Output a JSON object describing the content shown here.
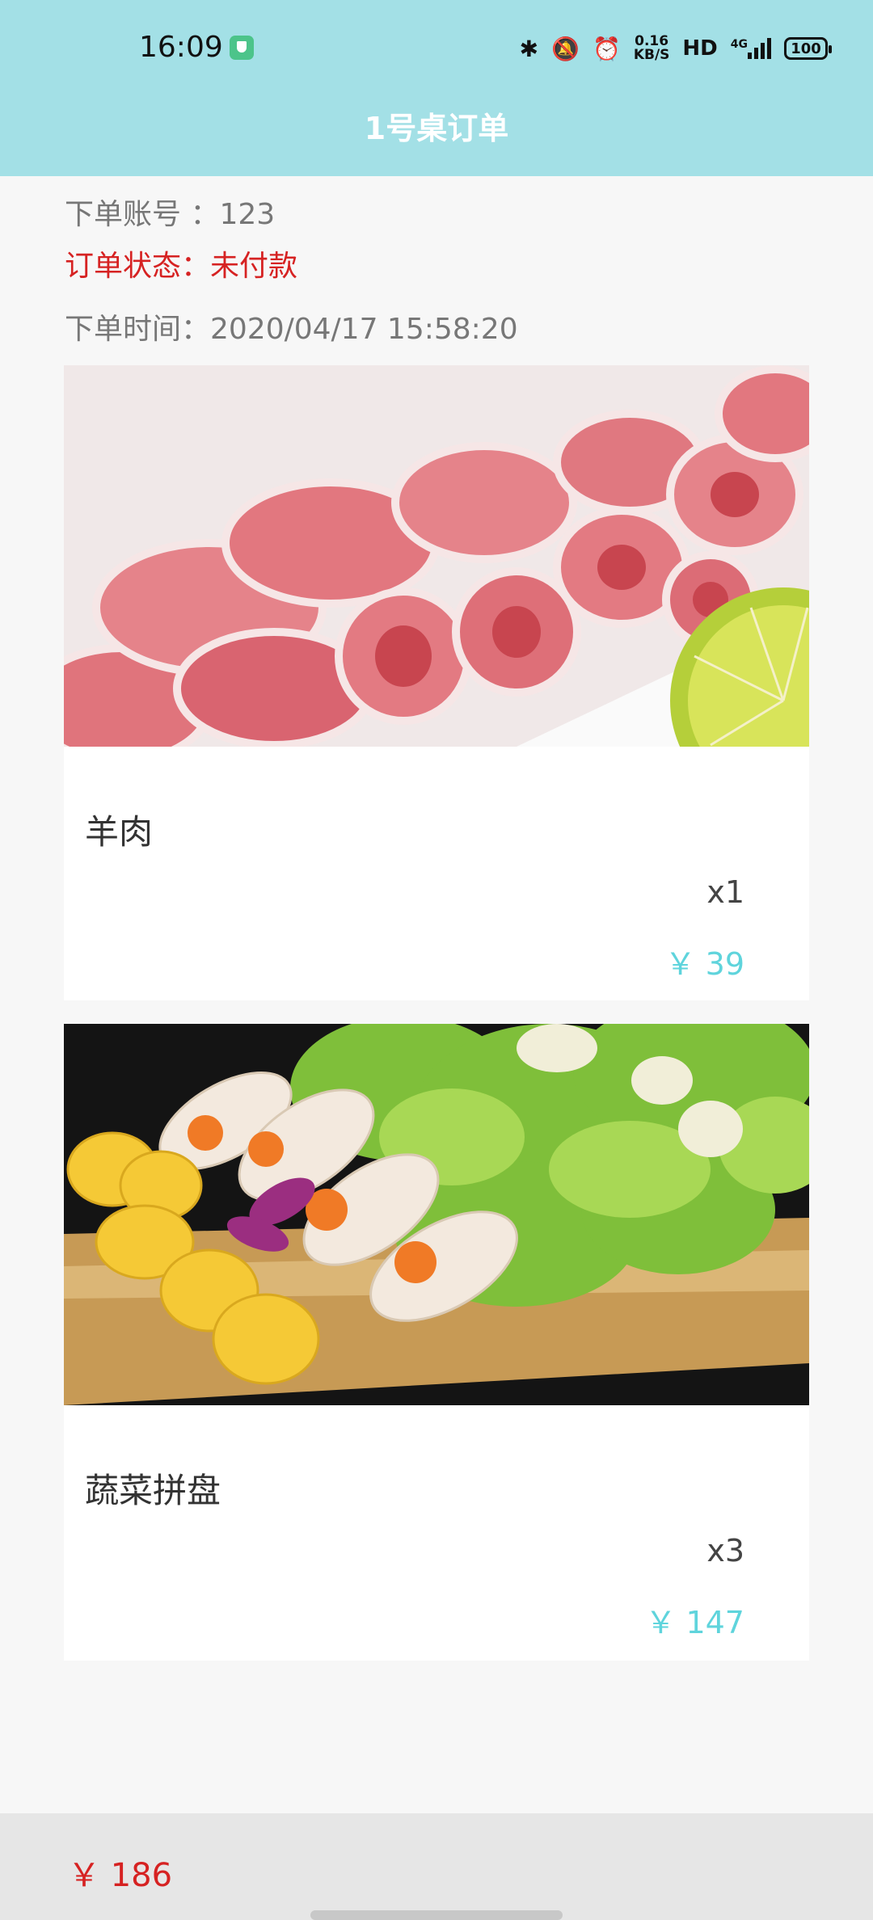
{
  "status_bar": {
    "time": "16:09",
    "speed_value": "0.16",
    "speed_unit": "KB/S",
    "hd": "HD",
    "network": "4G",
    "battery": "100",
    "icons": [
      "shield-icon",
      "bluetooth-icon",
      "mute-icon",
      "alarm-icon",
      "signal-icon",
      "battery-icon"
    ]
  },
  "header": {
    "title": "1号桌订单"
  },
  "order": {
    "account": "下单账号 ：123",
    "status": "订单状态：未付款",
    "time": "下单时间：2020/04/17 15:58:20"
  },
  "items": [
    {
      "name": "羊肉",
      "qty": "x1",
      "price": "￥ 39",
      "image": "lamb-rolls-photo"
    },
    {
      "name": "蔬菜拼盘",
      "qty": "x3",
      "price": "￥ 147",
      "image": "vegetable-platter-photo"
    }
  ],
  "footer": {
    "total": "￥ 186"
  },
  "colors": {
    "header_bg": "#a3e0e6",
    "status_red": "#d62222",
    "price_cyan": "#5fd4dc",
    "footer_bg": "#e6e6e6"
  }
}
